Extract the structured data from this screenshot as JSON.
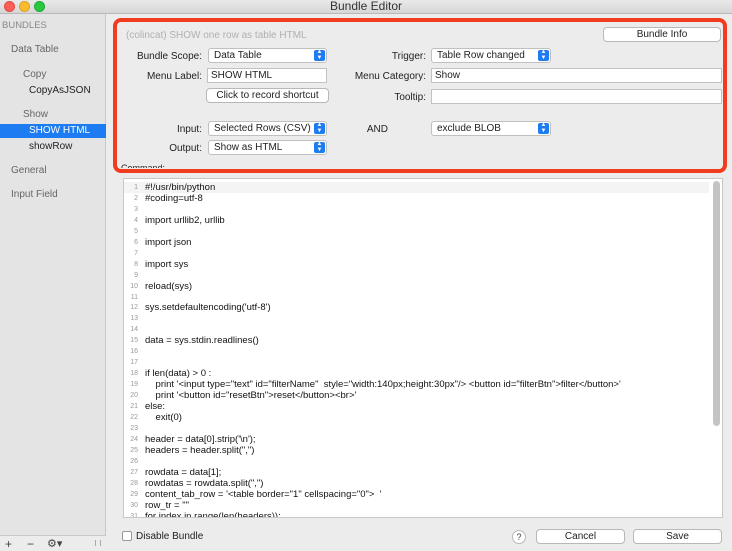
{
  "window": {
    "title": "Bundle Editor"
  },
  "sidebar": {
    "header": "BUNDLES",
    "items": [
      {
        "label": "Data Table",
        "kind": "group"
      },
      {
        "label": "Copy",
        "kind": "subgroup"
      },
      {
        "label": "CopyAsJSON",
        "kind": "leaf"
      },
      {
        "label": "Show",
        "kind": "subgroup"
      },
      {
        "label": "SHOW HTML",
        "kind": "leaf",
        "selected": true
      },
      {
        "label": "showRow",
        "kind": "leaf"
      },
      {
        "label": "General",
        "kind": "group"
      },
      {
        "label": "Input Field",
        "kind": "group"
      }
    ],
    "footer": {
      "add": "+",
      "remove": "−",
      "actions": "⚙▾"
    }
  },
  "form": {
    "description": "(colincat) SHOW one row as table HTML",
    "bundle_info_label": "Bundle Info",
    "bundle_scope": {
      "label": "Bundle Scope:",
      "value": "Data Table"
    },
    "trigger": {
      "label": "Trigger:",
      "value": "Table Row changed"
    },
    "menu_label": {
      "label": "Menu Label:",
      "value": "SHOW HTML"
    },
    "menu_category": {
      "label": "Menu Category:",
      "value": "Show"
    },
    "record_shortcut_label": "Click to record shortcut",
    "tooltip": {
      "label": "Tooltip:",
      "value": ""
    },
    "input": {
      "label": "Input:",
      "value": "Selected Rows (CSV)"
    },
    "and_label": "AND",
    "input_fallback": {
      "value": "exclude BLOB"
    },
    "output": {
      "label": "Output:",
      "value": "Show as HTML"
    },
    "command_label": "Command:"
  },
  "editor": {
    "lines": [
      "#!/usr/bin/python",
      "#coding=utf-8",
      "",
      "import urllib2, urllib",
      "",
      "import json",
      "",
      "import sys",
      "",
      "reload(sys)",
      "",
      "sys.setdefaultencoding('utf-8')",
      "",
      "",
      "data = sys.stdin.readlines()",
      "",
      "",
      "if len(data) > 0 :",
      "    print '<input type=\"text\" id=\"filterName\"  style=\"width:140px;height:30px\"/> <button id=\"filterBtn\">filter</button>'",
      "    print '<button id=\"resetBtn\">reset</button><br>'",
      "else:",
      "    exit(0)",
      "",
      "header = data[0].strip('\\n');",
      "headers = header.split(\",\")",
      "",
      "rowdata = data[1];",
      "rowdatas = rowdata.split(\",\")",
      "content_tab_row = '<table border=\"1\" cellspacing=\"0\">  '",
      "row_tr = \"\"",
      "for index in range(len(headers)):"
    ]
  },
  "bottom": {
    "disable_bundle_label": "Disable Bundle",
    "disable_bundle_checked": false,
    "help_label": "?",
    "cancel_label": "Cancel",
    "save_label": "Save"
  },
  "colors": {
    "highlight": "#f23c1f",
    "selection": "#1d7cf2"
  }
}
